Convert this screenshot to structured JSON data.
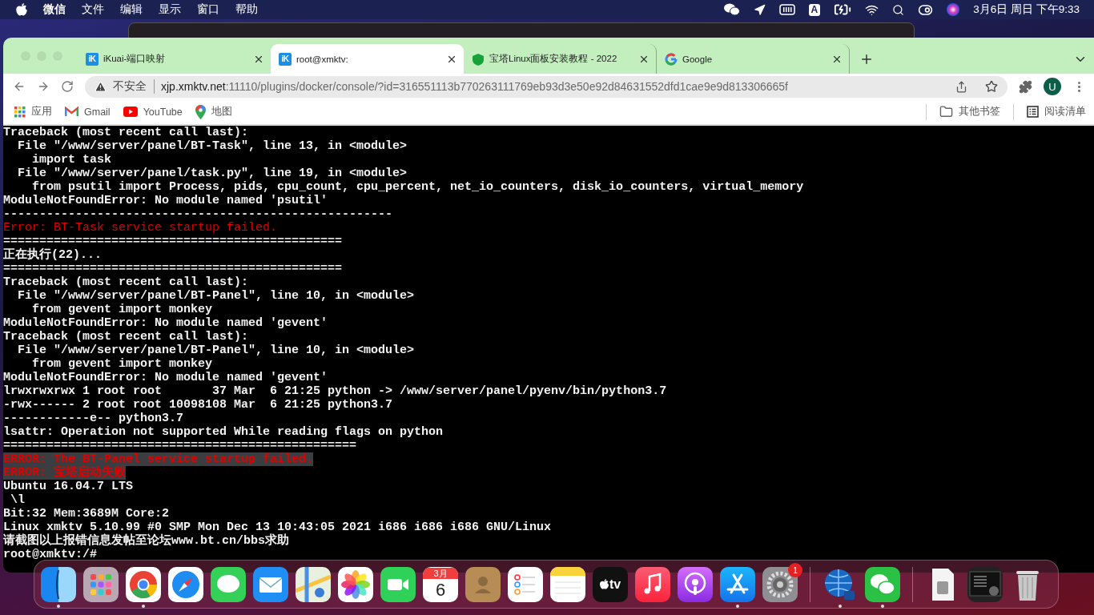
{
  "menu_bar": {
    "app_name": "微信",
    "menus": [
      "文件",
      "编辑",
      "显示",
      "窗口",
      "帮助"
    ],
    "status": [
      {
        "kind": "wechat"
      },
      {
        "kind": "location"
      },
      {
        "kind": "meter"
      },
      {
        "kind": "input",
        "label": "A"
      },
      {
        "kind": "battery"
      },
      {
        "kind": "wifi"
      },
      {
        "kind": "search"
      },
      {
        "kind": "control"
      },
      {
        "kind": "siri"
      }
    ],
    "clock": "3月6日 周日 下午9:33"
  },
  "browser": {
    "tabs": [
      {
        "title": "iKuai-端口映射",
        "kind": "ikuai",
        "favicon_text": "iK",
        "selected": false
      },
      {
        "title": "root@xmktv:",
        "kind": "ikuai",
        "favicon_text": "iK",
        "selected": true
      },
      {
        "title": "宝塔Linux面板安装教程 - 2022",
        "kind": "shield",
        "selected": false
      },
      {
        "title": "Google",
        "kind": "google",
        "selected": false
      }
    ],
    "address": {
      "security": "不安全",
      "host": "xjp.xmktv.net",
      "path": ":11110/plugins/docker/console/?id=316551113b770263111769eb93d3e50e92d84631552dfd1cae9e9d813306665f"
    },
    "profile_initial": "U",
    "bookmarks": [
      {
        "label": "应用",
        "kind": "apps"
      },
      {
        "label": "Gmail",
        "kind": "gmail"
      },
      {
        "label": "YouTube",
        "kind": "youtube"
      },
      {
        "label": "地图",
        "kind": "maps"
      }
    ],
    "bookmarks_right": [
      {
        "label": "其他书签",
        "kind": "folder"
      },
      {
        "label": "阅读清单",
        "kind": "reading"
      }
    ]
  },
  "terminal": {
    "lines": [
      {
        "kind": "normal",
        "text": "Traceback (most recent call last):"
      },
      {
        "kind": "normal",
        "text": "  File \"/www/server/panel/BT-Task\", line 13, in <module>"
      },
      {
        "kind": "normal",
        "text": "    import task"
      },
      {
        "kind": "normal",
        "text": "  File \"/www/server/panel/task.py\", line 19, in <module>"
      },
      {
        "kind": "normal",
        "text": "    from psutil import Process, pids, cpu_count, cpu_percent, net_io_counters, disk_io_counters, virtual_memory"
      },
      {
        "kind": "normal",
        "text": "ModuleNotFoundError: No module named 'psutil'"
      },
      {
        "kind": "normal",
        "text": "------------------------------------------------------"
      },
      {
        "kind": "error",
        "text": "Error: BT-Task service startup failed."
      },
      {
        "kind": "normal",
        "text": "==============================================="
      },
      {
        "kind": "normal",
        "text": "正在执行(22)..."
      },
      {
        "kind": "normal",
        "text": "==============================================="
      },
      {
        "kind": "normal",
        "text": "Traceback (most recent call last):"
      },
      {
        "kind": "normal",
        "text": "  File \"/www/server/panel/BT-Panel\", line 10, in <module>"
      },
      {
        "kind": "normal",
        "text": "    from gevent import monkey"
      },
      {
        "kind": "normal",
        "text": "ModuleNotFoundError: No module named 'gevent'"
      },
      {
        "kind": "normal",
        "text": "Traceback (most recent call last):"
      },
      {
        "kind": "normal",
        "text": "  File \"/www/server/panel/BT-Panel\", line 10, in <module>"
      },
      {
        "kind": "normal",
        "text": "    from gevent import monkey"
      },
      {
        "kind": "normal",
        "text": "ModuleNotFoundError: No module named 'gevent'"
      },
      {
        "kind": "normal",
        "text": "lrwxrwxrwx 1 root root       37 Mar  6 21:25 python -> /www/server/panel/pyenv/bin/python3.7"
      },
      {
        "kind": "normal",
        "text": "-rwx------ 2 root root 10098108 Mar  6 21:25 python3.7"
      },
      {
        "kind": "normal",
        "text": "------------e-- python3.7"
      },
      {
        "kind": "normal",
        "text": "lsattr: Operation not supported While reading flags on python"
      },
      {
        "kind": "normal",
        "text": "================================================="
      },
      {
        "kind": "highlight",
        "text": "ERROR: The BT-Panel service startup failed."
      },
      {
        "kind": "highlight",
        "text": "ERROR: 宝塔启动失败"
      },
      {
        "kind": "normal",
        "text": "Ubuntu 16.04.7 LTS"
      },
      {
        "kind": "normal",
        "text": " \\l"
      },
      {
        "kind": "normal",
        "text": "Bit:32 Mem:3689M Core:2"
      },
      {
        "kind": "normal",
        "text": "Linux xmktv 5.10.99 #0 SMP Mon Dec 13 10:43:05 2021 i686 i686 i686 GNU/Linux"
      },
      {
        "kind": "normal",
        "text": "请截图以上报错信息发帖至论坛www.bt.cn/bbs求助"
      },
      {
        "kind": "normal",
        "text": "root@xmktv:/#"
      }
    ]
  },
  "dock": [
    {
      "kind": "finder",
      "running": true
    },
    {
      "kind": "launchpad",
      "running": false
    },
    {
      "kind": "chrome",
      "running": true
    },
    {
      "kind": "safari",
      "running": false
    },
    {
      "kind": "messages",
      "running": false
    },
    {
      "kind": "mail",
      "running": false
    },
    {
      "kind": "maps",
      "running": false
    },
    {
      "kind": "photos",
      "running": false
    },
    {
      "kind": "facetime",
      "running": false
    },
    {
      "kind": "calendar",
      "running": false,
      "month": "3月",
      "day": "6"
    },
    {
      "kind": "contacts",
      "running": false
    },
    {
      "kind": "reminders",
      "running": false
    },
    {
      "kind": "notes",
      "running": false
    },
    {
      "kind": "tv",
      "running": false,
      "label": "tv"
    },
    {
      "kind": "music",
      "running": false
    },
    {
      "kind": "podcasts",
      "running": false
    },
    {
      "kind": "appstore",
      "running": true
    },
    {
      "kind": "settings",
      "running": false,
      "badge": "1"
    },
    {
      "kind": "separator"
    },
    {
      "kind": "network",
      "running": true
    },
    {
      "kind": "wechat",
      "running": true
    },
    {
      "kind": "separator"
    },
    {
      "kind": "document",
      "running": false
    },
    {
      "kind": "screenshot",
      "running": false
    },
    {
      "kind": "trash",
      "running": false
    }
  ]
}
